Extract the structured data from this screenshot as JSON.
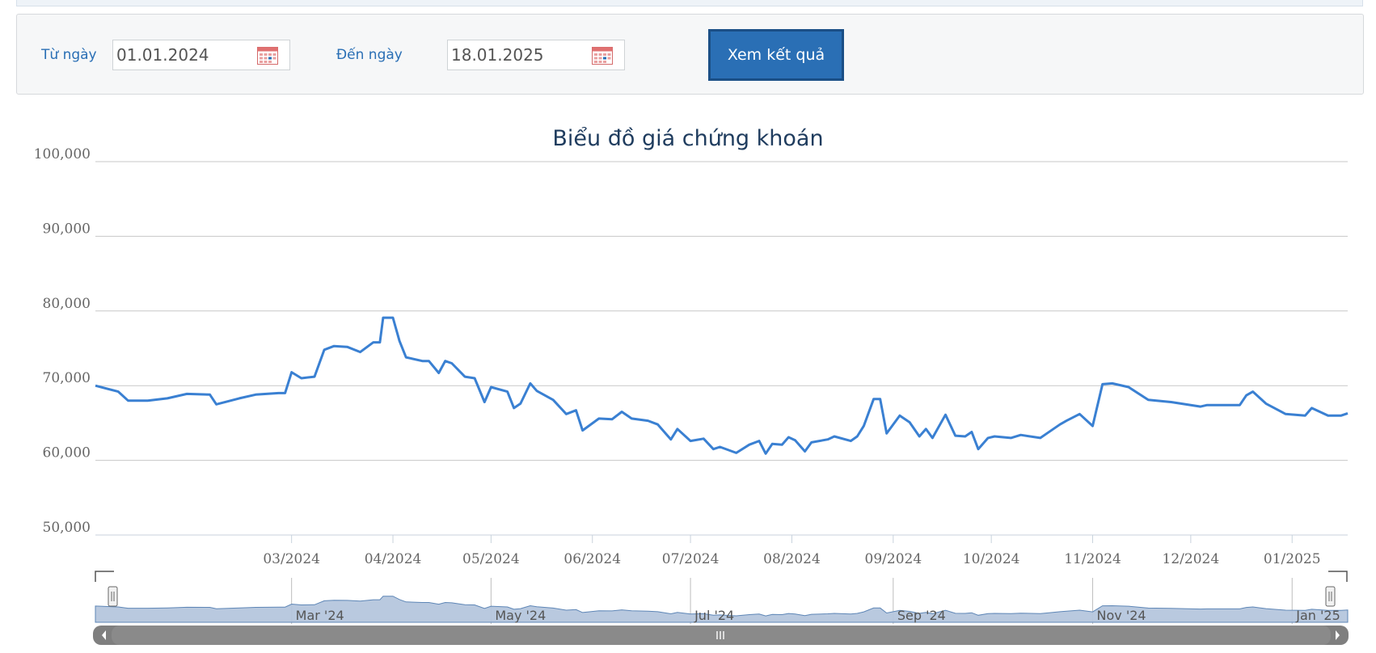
{
  "filter": {
    "from_label": "Từ ngày",
    "from_value": "01.01.2024",
    "to_label": "Đến ngày",
    "to_value": "18.01.2025",
    "submit_label": "Xem kết quả"
  },
  "colors": {
    "accent": "#2a6fb5",
    "line": "#3a80d2",
    "navigator_fill": "#b5c6dd",
    "scrollbar": "#7f7f7f"
  },
  "chart_data": {
    "type": "line",
    "title": "Biểu đồ giá chứng khoán",
    "ylim": [
      50000,
      100000
    ],
    "y_ticks": [
      "100,000",
      "90,000",
      "80,000",
      "70,000",
      "60,000",
      "50,000"
    ],
    "y_tick_values": [
      100000,
      90000,
      80000,
      70000,
      60000,
      50000
    ],
    "x_range": [
      "2024-01-01",
      "2025-01-18"
    ],
    "x_ticks": [
      {
        "label": "03/2024",
        "date": "2024-03-01"
      },
      {
        "label": "04/2024",
        "date": "2024-04-01"
      },
      {
        "label": "05/2024",
        "date": "2024-05-01"
      },
      {
        "label": "06/2024",
        "date": "2024-06-01"
      },
      {
        "label": "07/2024",
        "date": "2024-07-01"
      },
      {
        "label": "08/2024",
        "date": "2024-08-01"
      },
      {
        "label": "09/2024",
        "date": "2024-09-01"
      },
      {
        "label": "10/2024",
        "date": "2024-10-01"
      },
      {
        "label": "11/2024",
        "date": "2024-11-01"
      },
      {
        "label": "12/2024",
        "date": "2024-12-01"
      },
      {
        "label": "01/2025",
        "date": "2025-01-01"
      }
    ],
    "navigator_labels": [
      {
        "label": "Mar '24",
        "date": "2024-03-01"
      },
      {
        "label": "May '24",
        "date": "2024-05-01"
      },
      {
        "label": "Jul '24",
        "date": "2024-07-01"
      },
      {
        "label": "Sep '24",
        "date": "2024-09-01"
      },
      {
        "label": "Nov '24",
        "date": "2024-11-01"
      },
      {
        "label": "Jan '25",
        "date": "2025-01-01"
      }
    ],
    "grid": true,
    "series": [
      {
        "values": [
          [
            "2024-01-01",
            70000
          ],
          [
            "2024-01-08",
            69200
          ],
          [
            "2024-01-11",
            68000
          ],
          [
            "2024-01-17",
            68000
          ],
          [
            "2024-01-23",
            68300
          ],
          [
            "2024-01-29",
            68900
          ],
          [
            "2024-02-05",
            68800
          ],
          [
            "2024-02-07",
            67500
          ],
          [
            "2024-02-14",
            68300
          ],
          [
            "2024-02-19",
            68800
          ],
          [
            "2024-02-26",
            69000
          ],
          [
            "2024-02-28",
            69000
          ],
          [
            "2024-03-01",
            71800
          ],
          [
            "2024-03-04",
            71000
          ],
          [
            "2024-03-08",
            71200
          ],
          [
            "2024-03-11",
            74800
          ],
          [
            "2024-03-14",
            75300
          ],
          [
            "2024-03-18",
            75200
          ],
          [
            "2024-03-22",
            74500
          ],
          [
            "2024-03-26",
            75800
          ],
          [
            "2024-03-28",
            75800
          ],
          [
            "2024-03-29",
            79100
          ],
          [
            "2024-04-01",
            79100
          ],
          [
            "2024-04-03",
            76000
          ],
          [
            "2024-04-05",
            73800
          ],
          [
            "2024-04-10",
            73300
          ],
          [
            "2024-04-12",
            73300
          ],
          [
            "2024-04-15",
            71700
          ],
          [
            "2024-04-17",
            73300
          ],
          [
            "2024-04-19",
            73000
          ],
          [
            "2024-04-23",
            71200
          ],
          [
            "2024-04-26",
            71000
          ],
          [
            "2024-04-29",
            67800
          ],
          [
            "2024-05-01",
            69800
          ],
          [
            "2024-05-06",
            69200
          ],
          [
            "2024-05-08",
            67000
          ],
          [
            "2024-05-10",
            67600
          ],
          [
            "2024-05-13",
            70300
          ],
          [
            "2024-05-15",
            69300
          ],
          [
            "2024-05-20",
            68100
          ],
          [
            "2024-05-24",
            66200
          ],
          [
            "2024-05-27",
            66700
          ],
          [
            "2024-05-29",
            64000
          ],
          [
            "2024-06-03",
            65600
          ],
          [
            "2024-06-07",
            65500
          ],
          [
            "2024-06-10",
            66500
          ],
          [
            "2024-06-13",
            65600
          ],
          [
            "2024-06-18",
            65300
          ],
          [
            "2024-06-21",
            64800
          ],
          [
            "2024-06-25",
            62800
          ],
          [
            "2024-06-27",
            64200
          ],
          [
            "2024-07-01",
            62600
          ],
          [
            "2024-07-05",
            62900
          ],
          [
            "2024-07-08",
            61500
          ],
          [
            "2024-07-10",
            61800
          ],
          [
            "2024-07-15",
            61000
          ],
          [
            "2024-07-19",
            62100
          ],
          [
            "2024-07-22",
            62600
          ],
          [
            "2024-07-24",
            60900
          ],
          [
            "2024-07-26",
            62200
          ],
          [
            "2024-07-29",
            62100
          ],
          [
            "2024-07-31",
            63100
          ],
          [
            "2024-08-02",
            62700
          ],
          [
            "2024-08-05",
            61200
          ],
          [
            "2024-08-07",
            62400
          ],
          [
            "2024-08-12",
            62800
          ],
          [
            "2024-08-14",
            63200
          ],
          [
            "2024-08-19",
            62600
          ],
          [
            "2024-08-21",
            63200
          ],
          [
            "2024-08-23",
            64600
          ],
          [
            "2024-08-26",
            68200
          ],
          [
            "2024-08-28",
            68200
          ],
          [
            "2024-08-30",
            63600
          ],
          [
            "2024-09-03",
            66000
          ],
          [
            "2024-09-06",
            65100
          ],
          [
            "2024-09-09",
            63200
          ],
          [
            "2024-09-11",
            64200
          ],
          [
            "2024-09-13",
            63000
          ],
          [
            "2024-09-17",
            66100
          ],
          [
            "2024-09-20",
            63300
          ],
          [
            "2024-09-23",
            63200
          ],
          [
            "2024-09-25",
            63800
          ],
          [
            "2024-09-27",
            61500
          ],
          [
            "2024-09-30",
            63000
          ],
          [
            "2024-10-02",
            63200
          ],
          [
            "2024-10-07",
            63000
          ],
          [
            "2024-10-10",
            63400
          ],
          [
            "2024-10-16",
            63000
          ],
          [
            "2024-10-18",
            63600
          ],
          [
            "2024-10-22",
            64800
          ],
          [
            "2024-10-24",
            65300
          ],
          [
            "2024-10-28",
            66200
          ],
          [
            "2024-11-01",
            64600
          ],
          [
            "2024-11-04",
            70200
          ],
          [
            "2024-11-07",
            70300
          ],
          [
            "2024-11-12",
            69800
          ],
          [
            "2024-11-18",
            68100
          ],
          [
            "2024-11-25",
            67800
          ],
          [
            "2024-12-04",
            67200
          ],
          [
            "2024-12-06",
            67400
          ],
          [
            "2024-12-16",
            67400
          ],
          [
            "2024-12-18",
            68700
          ],
          [
            "2024-12-20",
            69200
          ],
          [
            "2024-12-24",
            67600
          ],
          [
            "2024-12-30",
            66200
          ],
          [
            "2025-01-05",
            66000
          ],
          [
            "2025-01-07",
            67000
          ],
          [
            "2025-01-12",
            66000
          ],
          [
            "2025-01-16",
            66000
          ],
          [
            "2025-01-18",
            66300
          ]
        ]
      }
    ]
  }
}
